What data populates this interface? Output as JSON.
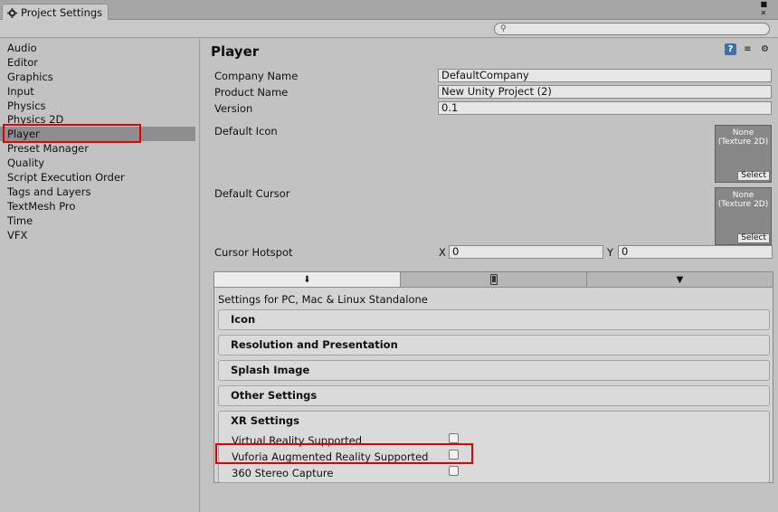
{
  "window": {
    "tab_title": "Project Settings",
    "tab_icon": "gear-icon",
    "menu_icon": "menu-icon",
    "close_icon": "close-icon"
  },
  "search": {
    "placeholder": "",
    "icon": "search-icon"
  },
  "sidebar": {
    "items": [
      {
        "label": "Audio"
      },
      {
        "label": "Editor"
      },
      {
        "label": "Graphics"
      },
      {
        "label": "Input"
      },
      {
        "label": "Physics"
      },
      {
        "label": "Physics 2D"
      },
      {
        "label": "Player"
      },
      {
        "label": "Preset Manager"
      },
      {
        "label": "Quality"
      },
      {
        "label": "Script Execution Order"
      },
      {
        "label": "Tags and Layers"
      },
      {
        "label": "TextMesh Pro"
      },
      {
        "label": "Time"
      },
      {
        "label": "VFX"
      }
    ],
    "active": "Player"
  },
  "player": {
    "title": "Player",
    "header_icons": [
      "help-icon",
      "preset-icon",
      "settings-gear-icon"
    ],
    "company_name_label": "Company Name",
    "company_name_value": "DefaultCompany",
    "product_name_label": "Product Name",
    "product_name_value": "New Unity Project (2)",
    "version_label": "Version",
    "version_value": "0.1",
    "default_icon_label": "Default Icon",
    "default_cursor_label": "Default Cursor",
    "texture_none": "None",
    "texture_type": "(Texture 2D)",
    "select_label": "Select",
    "cursor_hotspot_label": "Cursor Hotspot",
    "x_label": "X",
    "x_value": "0",
    "y_label": "Y",
    "y_value": "0"
  },
  "platform_tabs": [
    {
      "name": "pc-standalone-icon",
      "active": true
    },
    {
      "name": "mobile-icon",
      "active": false
    },
    {
      "name": "android-icon",
      "active": false
    }
  ],
  "platform_panel": {
    "settings_for": "Settings for PC, Mac & Linux Standalone",
    "sections": [
      "Icon",
      "Resolution and Presentation",
      "Splash Image",
      "Other Settings"
    ],
    "xr_title": "XR Settings",
    "xr_options": [
      {
        "label": "Virtual Reality Supported",
        "checked": false
      },
      {
        "label": "Vuforia Augmented Reality Supported",
        "checked": false
      },
      {
        "label": "360 Stereo Capture",
        "checked": false
      }
    ]
  },
  "colors": {
    "highlight": "#e00000",
    "active_sidebar": "#8e8e8e",
    "background": "#c2c2c2"
  }
}
